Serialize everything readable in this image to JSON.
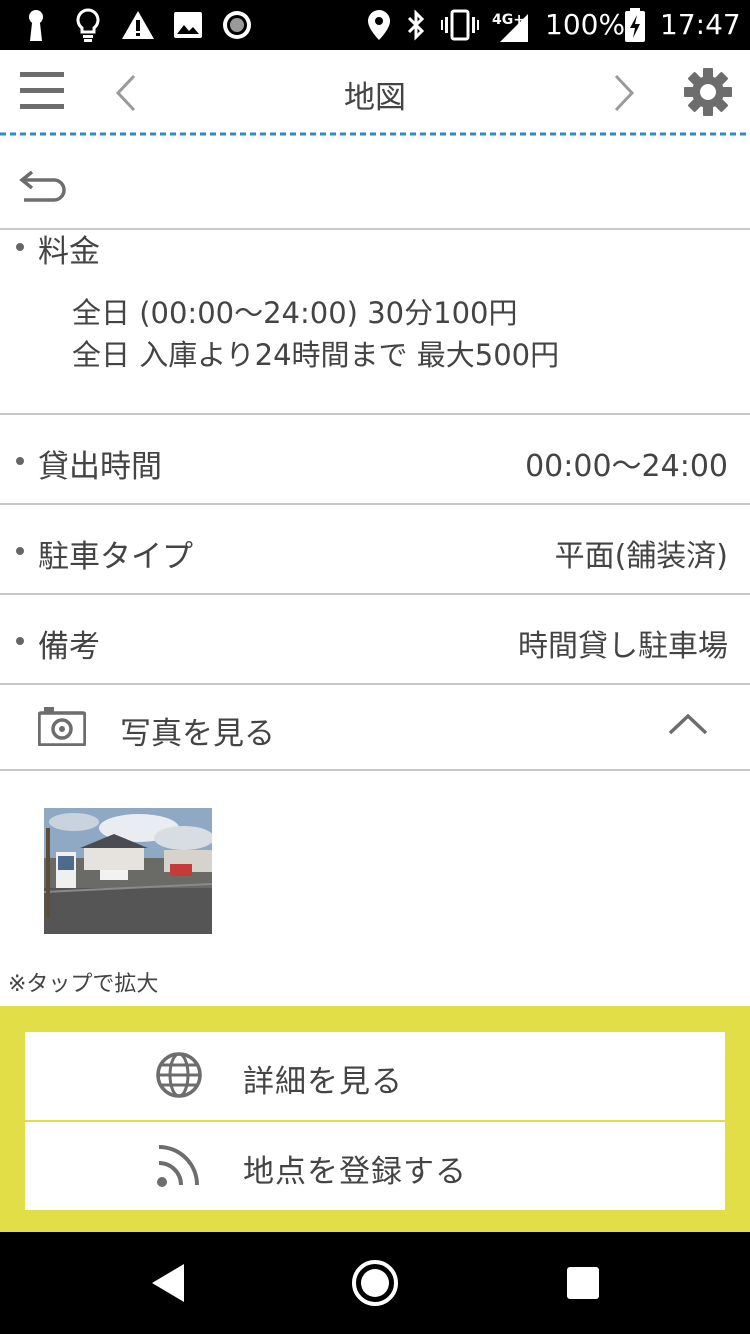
{
  "status_bar": {
    "network": "4G+",
    "battery": "100%",
    "time": "17:47",
    "icons": [
      "keyhole-icon",
      "lightbulb-icon",
      "warning-icon",
      "image-icon",
      "record-icon",
      "location-pin-icon",
      "bluetooth-icon",
      "vibrate-icon",
      "signal-icon",
      "battery-charging-icon"
    ]
  },
  "header": {
    "title": "地図",
    "icons": [
      "menu-icon",
      "chevron-left-icon",
      "chevron-right-icon",
      "gear-icon"
    ]
  },
  "back": {
    "icon": "back-arrow-icon"
  },
  "fee": {
    "label": "料金",
    "lines": [
      "全日 (00:00〜24:00) 30分100円",
      "全日 入庫より24時間まで 最大500円"
    ]
  },
  "rows": [
    {
      "label": "貸出時間",
      "value": "00:00〜24:00"
    },
    {
      "label": "駐車タイプ",
      "value": "平面(舗装済)"
    },
    {
      "label": "備考",
      "value": "時間貸し駐車場"
    }
  ],
  "photos": {
    "label": "写真を見る",
    "note": "※タップで拡大",
    "icons": [
      "camera-icon",
      "chevron-up-icon"
    ]
  },
  "actions": [
    {
      "label": "詳細を見る",
      "icon": "globe-icon"
    },
    {
      "label": "地点を登録する",
      "icon": "rss-icon"
    }
  ],
  "nav_bar": {
    "icons": [
      "back-triangle-icon",
      "home-circle-icon",
      "recents-square-icon"
    ]
  },
  "colors": {
    "accent_yellow": "#e1de47",
    "header_dash": "#2f8ac8",
    "divider": "#c8c8c8",
    "icon_gray": "#6d6d6d"
  }
}
